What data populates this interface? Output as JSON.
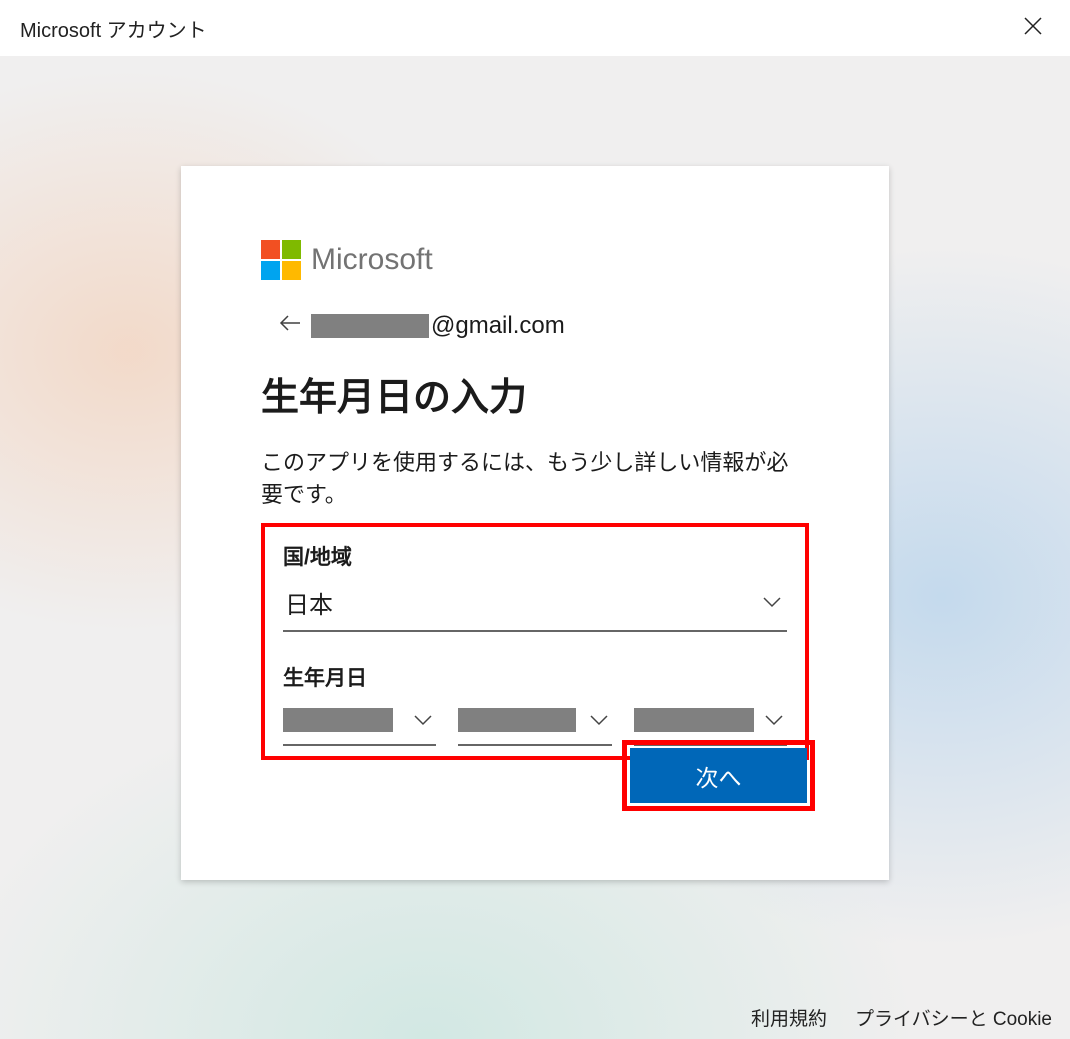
{
  "window": {
    "title": "Microsoft アカウント"
  },
  "brand": "Microsoft",
  "identity": {
    "email_suffix": "@gmail.com"
  },
  "heading": "生年月日の入力",
  "subtext": "このアプリを使用するには、もう少し詳しい情報が必要です。",
  "form": {
    "country_label": "国/地域",
    "country_value": "日本",
    "birth_label": "生年月日"
  },
  "buttons": {
    "next": "次へ"
  },
  "footer": {
    "terms": "利用規約",
    "privacy": "プライバシーと Cookie"
  }
}
